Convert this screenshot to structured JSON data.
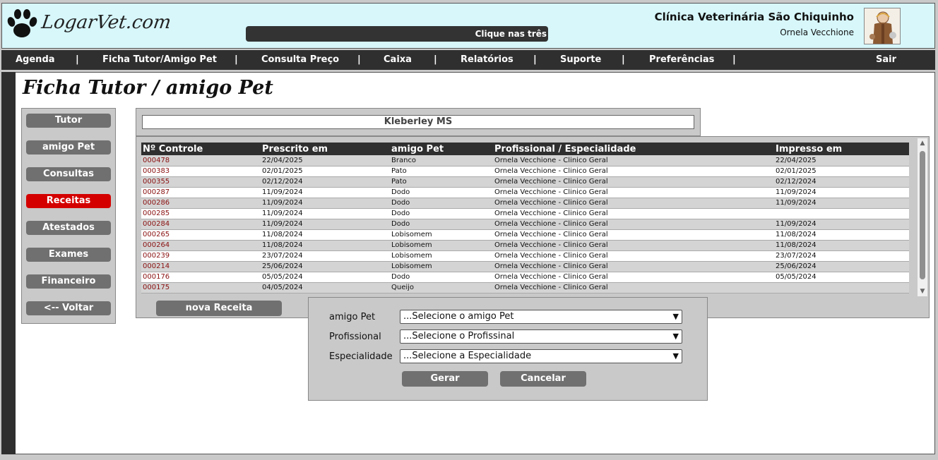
{
  "header": {
    "logo_text": "LogarVet.com",
    "marquee_text": "Clique nas três",
    "clinic_name": "Clínica Veterinária São Chiquinho",
    "user_name": "Ornela Vecchione"
  },
  "nav": {
    "items": [
      "Agenda",
      "Ficha Tutor/Amigo Pet",
      "Consulta Preço",
      "Caixa",
      "Relatórios",
      "Suporte",
      "Preferências",
      "Sair"
    ],
    "separator": "|"
  },
  "page_title": "Ficha Tutor / amigo Pet",
  "side_menu": {
    "items": [
      "Tutor",
      "amigo Pet",
      "Consultas",
      "Receitas",
      "Atestados",
      "Exames",
      "Financeiro",
      "<-- Voltar"
    ],
    "active": "Receitas"
  },
  "tutor_name": "Kleberley MS",
  "table": {
    "headers": [
      "Nº Controle",
      "Prescrito em",
      "amigo Pet",
      "Profissional / Especialidade",
      "Impresso em"
    ],
    "rows": [
      [
        "000478",
        "22/04/2025",
        "Branco",
        "Ornela Vecchione  -  Clinico Geral",
        "22/04/2025"
      ],
      [
        "000383",
        "02/01/2025",
        "Pato",
        "Ornela Vecchione  -  Clinico Geral",
        "02/01/2025"
      ],
      [
        "000355",
        "02/12/2024",
        "Pato",
        "Ornela Vecchione  -  Clinico Geral",
        "02/12/2024"
      ],
      [
        "000287",
        "11/09/2024",
        "Dodo",
        "Ornela Vecchione  -  Clinico Geral",
        "11/09/2024"
      ],
      [
        "000286",
        "11/09/2024",
        "Dodo",
        "Ornela Vecchione  -  Clinico Geral",
        "11/09/2024"
      ],
      [
        "000285",
        "11/09/2024",
        "Dodo",
        "Ornela Vecchione  -  Clinico Geral",
        ""
      ],
      [
        "000284",
        "11/09/2024",
        "Dodo",
        "Ornela Vecchione  -  Clinico Geral",
        "11/09/2024"
      ],
      [
        "000265",
        "11/08/2024",
        "Lobisomem",
        "Ornela Vecchione  -  Clinico Geral",
        "11/08/2024"
      ],
      [
        "000264",
        "11/08/2024",
        "Lobisomem",
        "Ornela Vecchione  -  Clinico Geral",
        "11/08/2024"
      ],
      [
        "000239",
        "23/07/2024",
        "Lobisomem",
        "Ornela Vecchione  -  Clinico Geral",
        "23/07/2024"
      ],
      [
        "000214",
        "25/06/2024",
        "Lobisomem",
        "Ornela Vecchione  -  Clinico Geral",
        "25/06/2024"
      ],
      [
        "000176",
        "05/05/2024",
        "Dodo",
        "Ornela Vecchione  -  Clinico Geral",
        "05/05/2024"
      ],
      [
        "000175",
        "04/05/2024",
        "Queijo",
        "Ornela Vecchione  -  Clinico Geral",
        ""
      ]
    ]
  },
  "nova_receita_label": "nova Receita",
  "form": {
    "pet_label": "amigo Pet",
    "pet_value": "...Selecione o amigo Pet",
    "prof_label": "Profissional",
    "prof_value": "...Selecione o Profissinal",
    "esp_label": "Especialidade",
    "esp_value": "...Selecione a Especialidade",
    "gerar_label": "Gerar",
    "cancelar_label": "Cancelar"
  },
  "colors": {
    "header_bg": "#d7f7fb",
    "nav_bg": "#2f2f2f",
    "active_menu": "#d40000",
    "button_gray": "#707070",
    "control_link": "#8a1010"
  }
}
